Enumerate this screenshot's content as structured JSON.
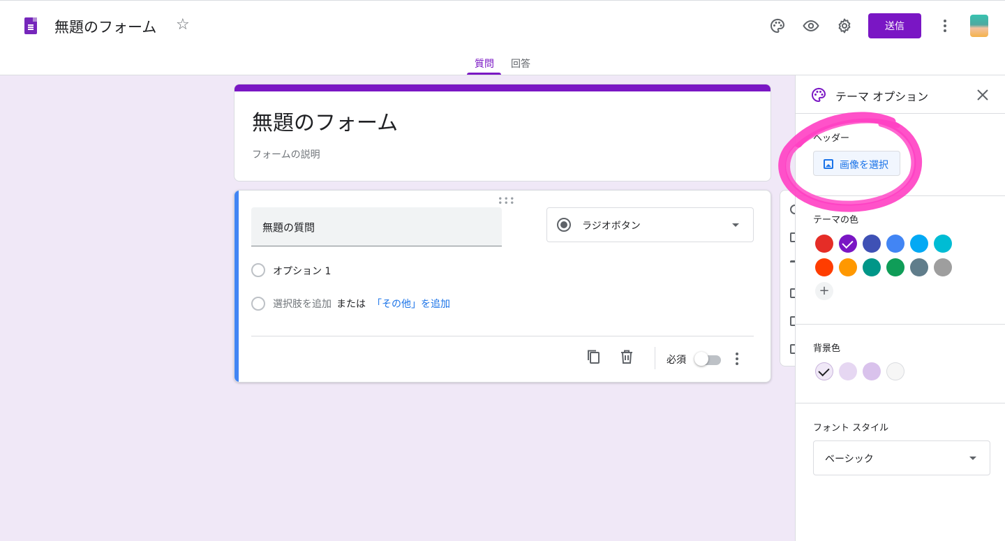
{
  "header": {
    "doc_title": "無題のフォーム",
    "send_label": "送信",
    "icons": [
      "star-icon",
      "palette-icon",
      "eye-icon",
      "gear-icon",
      "more-vert-icon"
    ]
  },
  "tabs": {
    "questions": "質問",
    "responses": "回答",
    "active": "questions"
  },
  "form": {
    "title": "無題のフォーム",
    "description": "フォームの説明"
  },
  "question": {
    "title": "無題の質問",
    "type": "ラジオボタン",
    "option1": "オプション 1",
    "add_option": "選択肢を追加",
    "or": "または",
    "add_other": "「その他」を追加",
    "required_label": "必須",
    "required": false
  },
  "theme_panel": {
    "title": "テーマ オプション",
    "header_label": "ヘッダー",
    "select_image": "画像を選択",
    "theme_color_label": "テーマの色",
    "theme_colors": [
      "#e52d27",
      "#7a16c4",
      "#3f51b5",
      "#4285f4",
      "#03a9f4",
      "#00bcd4",
      "#ff3d00",
      "#ff9800",
      "#009688",
      "#0f9d58",
      "#607d8b",
      "#9e9e9e"
    ],
    "selected_theme_color": "#7a16c4",
    "background_label": "背景色",
    "background_colors": [
      "#f0e8f7",
      "#e6d7f2",
      "#d9c2ec",
      "#f6f6f6"
    ],
    "selected_background": "#f0e8f7",
    "font_style_label": "フォント スタイル",
    "font_style": "ベーシック"
  },
  "colors": {
    "accent": "#7a16c4",
    "question_accent": "#4285f4",
    "highlight": "#ff3fc3"
  }
}
